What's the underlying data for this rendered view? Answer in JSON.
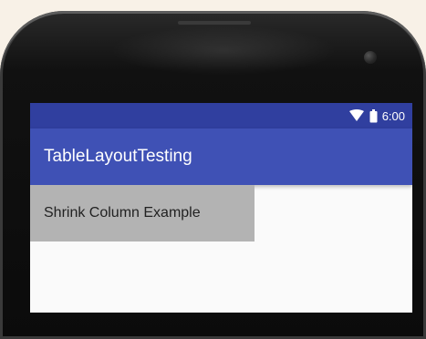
{
  "status_bar": {
    "time": "6:00",
    "icons": [
      "wifi-icon",
      "battery-icon"
    ]
  },
  "app_bar": {
    "title": "TableLayoutTesting"
  },
  "table": {
    "rows": [
      {
        "cells": [
          "Shrink Column Example"
        ]
      }
    ]
  },
  "colors": {
    "status_bar": "#303f9f",
    "app_bar": "#3f51b5",
    "cell_background": "#b3b3b3",
    "screen_background": "#fafafa"
  }
}
